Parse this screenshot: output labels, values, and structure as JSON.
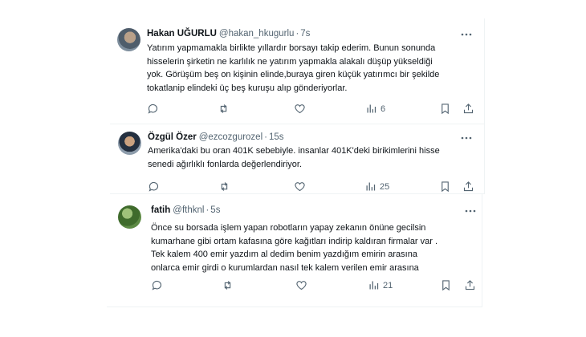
{
  "tweets": [
    {
      "name": "Hakan UĞURLU",
      "handle": "@hakan_hkugurlu",
      "separator": "·",
      "time": "7s",
      "lines": [
        "Yatırım yapmamakla birlikte yıllardır borsayı takip ederim. Bunun sonunda",
        "hisselerin şirketin ne karlılık ne yatırım yapmakla alakalı düşüp yükseldiği",
        "yok. Görüşüm beş on kişinin elinde,buraya giren küçük yatırımcı bir şekilde",
        "tokatlanip elindeki üç beş kuruşu alıp gönderiyorlar."
      ],
      "views": "6"
    },
    {
      "name": "Özgül Özer",
      "handle": "@ezcozgurozel",
      "separator": "·",
      "time": "15s",
      "lines": [
        "Amerika'daki bu oran 401K sebebiyle. insanlar 401K'deki birikimlerini hisse",
        "senedi ağırlıklı fonlarda değerlendiriyor."
      ],
      "views": "25"
    },
    {
      "name": "fatih",
      "handle": "@fthknl",
      "separator": "·",
      "time": "5s",
      "lines": [
        "Önce su borsada işlem yapan robotların yapay zekanın önüne gecilsin",
        "kumarhane gibi ortam kafasına göre kağıtları indirip kaldıran firmalar var .",
        "Tek kalem 400 emir yazdım al dedim benim yazdığım emirin arasına",
        "onlarca emir girdi o kurumlardan nasıl tek kalem verilen emir arasına"
      ],
      "views": "21"
    }
  ],
  "icons": {
    "more": "more-horizontal-icon",
    "reply": "reply-icon",
    "retweet": "retweet-icon",
    "like": "heart-icon",
    "views": "views-icon",
    "bookmark": "bookmark-icon",
    "share": "share-icon"
  },
  "colors": {
    "text": "#0f1419",
    "secondary": "#536471",
    "border": "#eff3f4"
  }
}
